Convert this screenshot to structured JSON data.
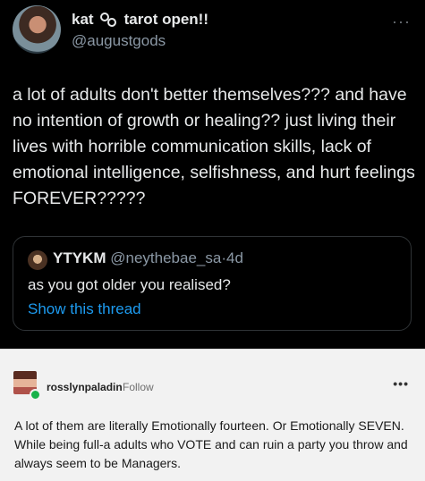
{
  "tweet": {
    "display_name": "kat",
    "name_suffix": "tarot open!!",
    "handle": "@augustgods",
    "more_label": "···",
    "text": "a lot of adults don't better themselves??? and have no intention of growth or healing?? just living their lives with horrible communication skills, lack of emotional intelligence, selfishness, and hurt feelings FOREVER?????",
    "quote": {
      "name": "YTYKM",
      "handle": "@neythebae_sa",
      "separator": "·",
      "age": "4d",
      "text": "as you got older you realised?",
      "link": "Show this thread"
    }
  },
  "tumblr": {
    "username": "rosslynpaladin",
    "follow_label": "Follow",
    "more_label": "•••",
    "text": "A lot of them are literally Emotionally fourteen. Or Emotionally SEVEN. While being full-a adults who VOTE and can ruin a party you throw and always seem to be Managers."
  },
  "colors": {
    "tweet_bg": "#000000",
    "link_blue": "#1d9bf0",
    "tumblr_bg": "#f2f2f2",
    "online_badge": "#19b24b"
  }
}
